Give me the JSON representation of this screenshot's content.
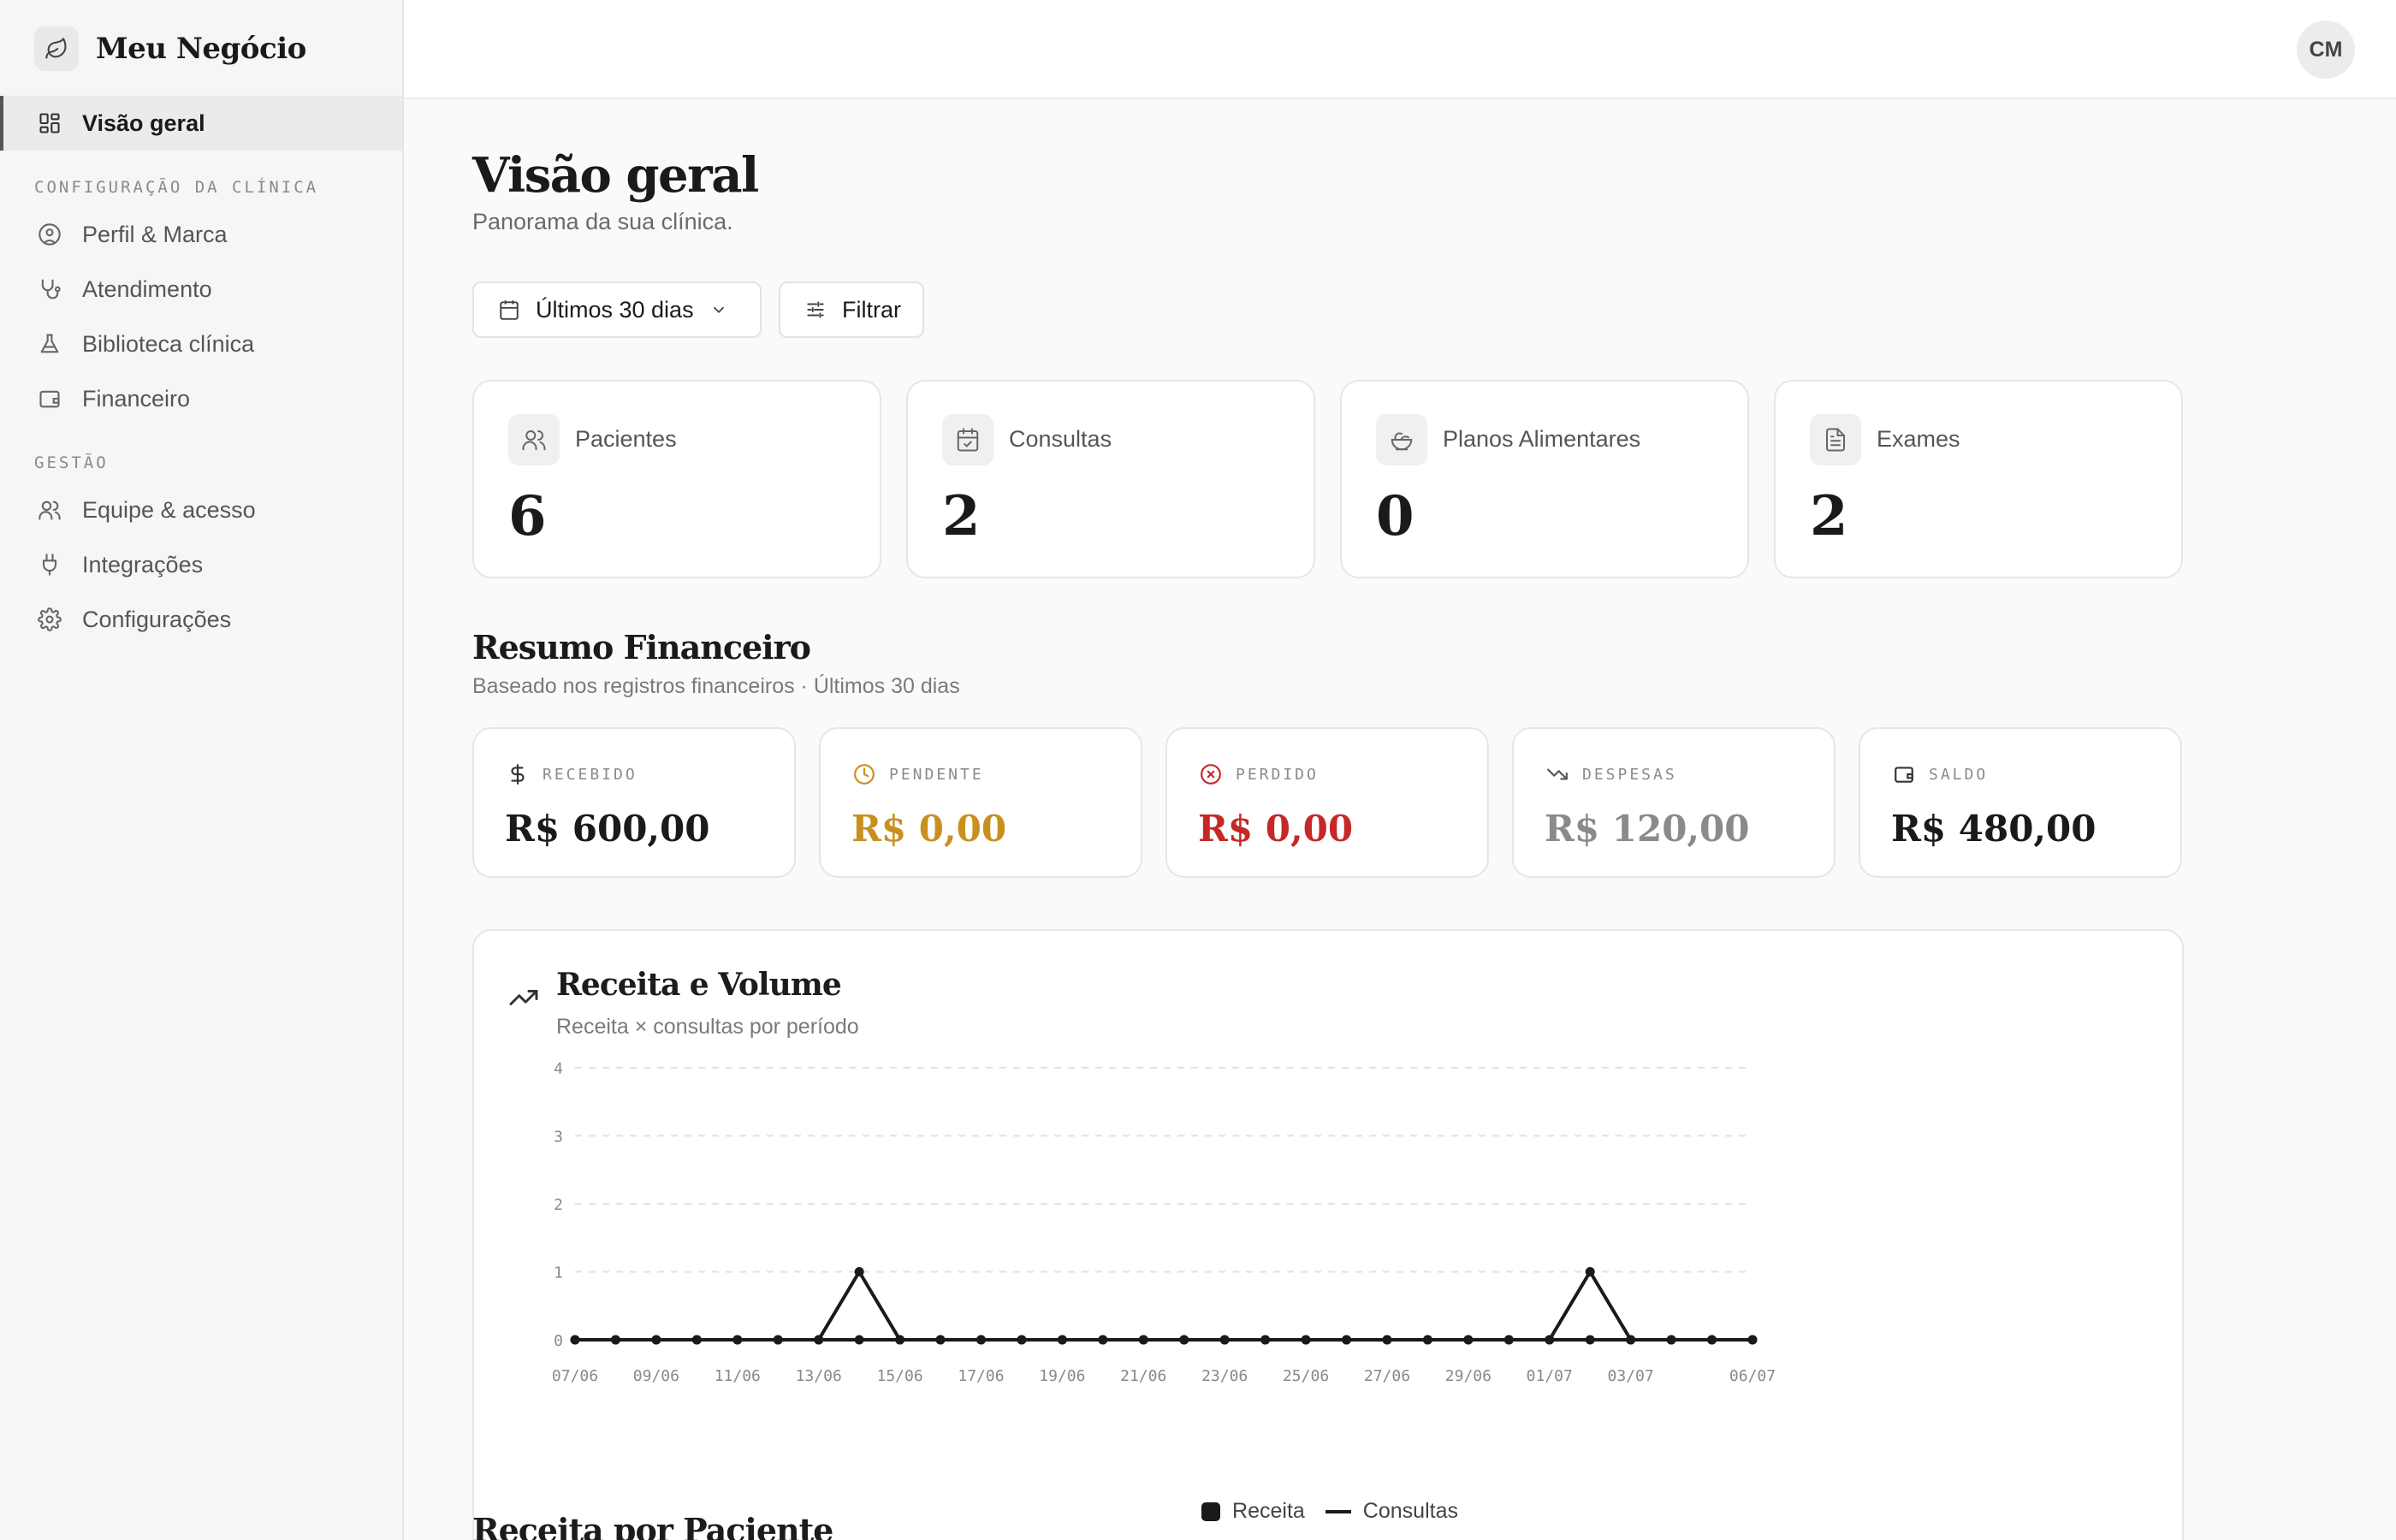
{
  "brand": {
    "name": "Meu Negócio",
    "icon": "leaf-icon"
  },
  "user": {
    "initials": "CM"
  },
  "sidebar": {
    "items": [
      {
        "label": "Visão geral",
        "icon": "grid-icon",
        "active": true
      },
      {
        "label": "Perfil & Marca",
        "icon": "user-circle-icon"
      },
      {
        "label": "Atendimento",
        "icon": "stethoscope-icon"
      },
      {
        "label": "Biblioteca clínica",
        "icon": "flask-icon"
      },
      {
        "label": "Financeiro",
        "icon": "wallet-icon"
      },
      {
        "label": "Equipe & acesso",
        "icon": "users-icon"
      },
      {
        "label": "Integrações",
        "icon": "plug-icon"
      },
      {
        "label": "Configurações",
        "icon": "gear-icon"
      }
    ],
    "sections": [
      "CONFIGURAÇÃO DA CLÍNICA",
      "GESTÃO"
    ]
  },
  "header": {
    "title": "Visão geral",
    "subtitle": "Panorama da sua clínica."
  },
  "filters": {
    "period": "Últimos 30 dias",
    "filter": "Filtrar"
  },
  "stats": [
    {
      "label": "Pacientes",
      "value": "6",
      "icon": "users-icon"
    },
    {
      "label": "Consultas",
      "value": "2",
      "icon": "calendar-check-icon"
    },
    {
      "label": "Planos Alimentares",
      "value": "0",
      "icon": "salad-icon"
    },
    {
      "label": "Exames",
      "value": "2",
      "icon": "document-icon"
    }
  ],
  "finance": {
    "title": "Resumo Financeiro",
    "subtitle": "Baseado nos registros financeiros · Últimos 30 dias",
    "cards": [
      {
        "label": "RECEBIDO",
        "value": "R$ 600,00",
        "icon": "dollar-icon",
        "color": "#1a1a1a",
        "icon_color": "#333333"
      },
      {
        "label": "PENDENTE",
        "value": "R$ 0,00",
        "icon": "clock-icon",
        "color": "#c8901e",
        "icon_color": "#c8901e"
      },
      {
        "label": "PERDIDO",
        "value": "R$ 0,00",
        "icon": "x-circle-icon",
        "color": "#c62828",
        "icon_color": "#c62828"
      },
      {
        "label": "DESPESAS",
        "value": "R$ 120,00",
        "icon": "trending-down-icon",
        "color": "#8a8a8a",
        "icon_color": "#555555"
      },
      {
        "label": "SALDO",
        "value": "R$ 480,00",
        "icon": "wallet-icon",
        "color": "#1a1a1a",
        "icon_color": "#333333"
      }
    ]
  },
  "chart": {
    "title": "Receita e Volume",
    "subtitle": "Receita × consultas por período",
    "icon": "trending-up-icon"
  },
  "chart_data": {
    "type": "line",
    "x": [
      "07/06",
      "08/06",
      "09/06",
      "10/06",
      "11/06",
      "12/06",
      "13/06",
      "14/06",
      "15/06",
      "16/06",
      "17/06",
      "18/06",
      "19/06",
      "20/06",
      "21/06",
      "22/06",
      "23/06",
      "24/06",
      "25/06",
      "26/06",
      "27/06",
      "28/06",
      "29/06",
      "30/06",
      "01/07",
      "02/07",
      "03/07",
      "04/07",
      "05/07",
      "06/07"
    ],
    "x_tick_labels": [
      "07/06",
      "09/06",
      "11/06",
      "13/06",
      "15/06",
      "17/06",
      "19/06",
      "21/06",
      "23/06",
      "25/06",
      "27/06",
      "29/06",
      "01/07",
      "03/07",
      "06/07"
    ],
    "x_tick_indices": [
      0,
      2,
      4,
      6,
      8,
      10,
      12,
      14,
      16,
      18,
      20,
      22,
      24,
      26,
      29
    ],
    "series": [
      {
        "name": "Receita",
        "values": [
          0,
          0,
          0,
          0,
          0,
          0,
          0,
          0,
          0,
          0,
          0,
          0,
          0,
          0,
          0,
          0,
          0,
          0,
          0,
          0,
          0,
          0,
          0,
          0,
          0,
          0,
          0,
          0,
          0,
          0
        ]
      },
      {
        "name": "Consultas",
        "values": [
          0,
          0,
          0,
          0,
          0,
          0,
          0,
          1,
          0,
          0,
          0,
          0,
          0,
          0,
          0,
          0,
          0,
          0,
          0,
          0,
          0,
          0,
          0,
          0,
          0,
          1,
          0,
          0,
          0,
          0
        ]
      }
    ],
    "ylim": [
      0,
      4
    ],
    "yticks": [
      "0",
      "1",
      "2",
      "3",
      "4"
    ],
    "grid": true,
    "legend": "bottom-center",
    "color": "#1a1a1a"
  },
  "next_section": {
    "title": "Receita por Paciente"
  }
}
